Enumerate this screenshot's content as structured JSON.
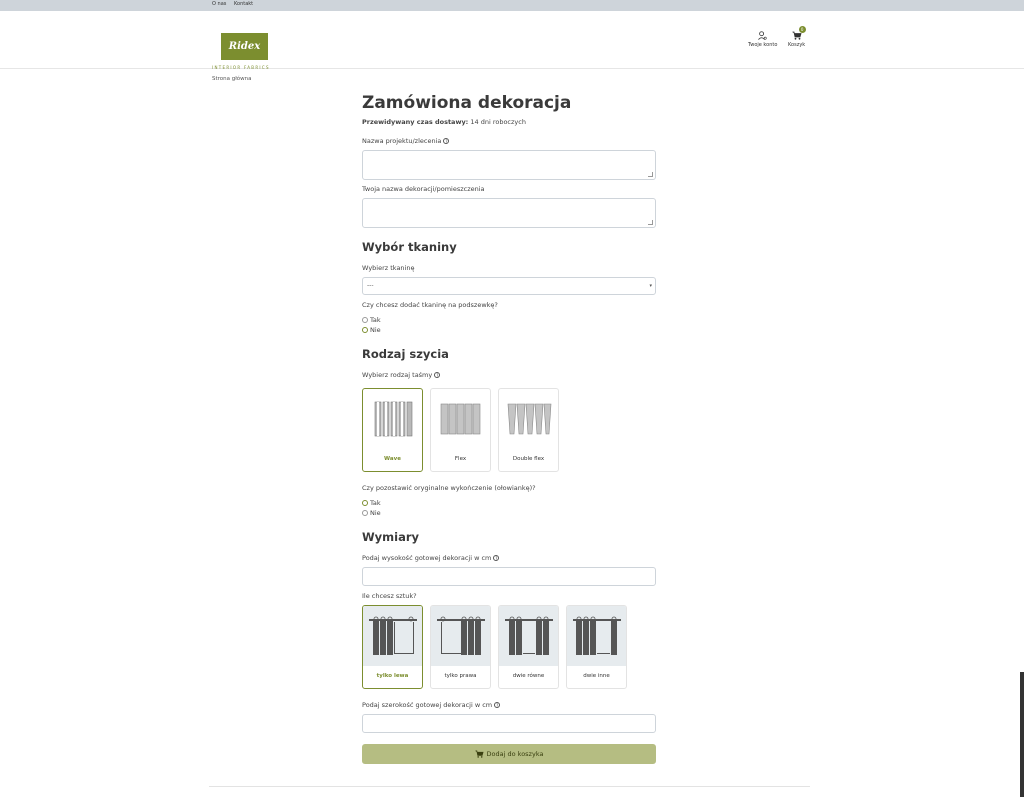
{
  "topbar": {
    "about": "O nas",
    "contact": "Kontakt"
  },
  "header": {
    "logo_text": "Ridex",
    "logo_sub": "INTERIOR FABRICS",
    "account_label": "Twoje konto",
    "cart_label": "Koszyk",
    "cart_count": "0"
  },
  "breadcrumb": {
    "home": "Strona główna"
  },
  "page": {
    "title": "Zamówiona dekoracja",
    "delivery_label": "Przewidywany czas dostawy:",
    "delivery_value": "14 dni roboczych"
  },
  "form": {
    "project_label": "Nazwa projektu/zlecenia",
    "project_value": "",
    "room_label": "Twoja nazwa dekoracji/pomieszczenia",
    "room_value": "",
    "fabric_heading": "Wybór tkaniny",
    "fabric_label": "Wybierz tkaninę",
    "fabric_selected": "---",
    "lining_label": "Czy chcesz dodać tkaninę na podszewkę?",
    "lining_yes": "Tak",
    "lining_no": "Nie",
    "sewing_heading": "Rodzaj szycia",
    "tape_label": "Wybierz rodzaj taśmy",
    "tapes": [
      "Wave",
      "Flex",
      "Double flex"
    ],
    "finish_label": "Czy pozostawić oryginalne wykończenie (ołowiankę)?",
    "finish_yes": "Tak",
    "finish_no": "Nie",
    "dims_heading": "Wymiary",
    "height_label": "Podaj wysokość gotowej dekoracji w cm",
    "height_value": "",
    "pieces_label": "Ile chcesz sztuk?",
    "pieces": [
      "tylko lewa",
      "tylko prawa",
      "dwie równe",
      "dwie inne"
    ],
    "width_label": "Podaj szerokość gotowej dekoracji w cm",
    "width_value": "",
    "submit_label": "Dodaj do koszyka"
  },
  "colors": {
    "accent": "#7c8e2f",
    "button": "#b5bd82"
  }
}
